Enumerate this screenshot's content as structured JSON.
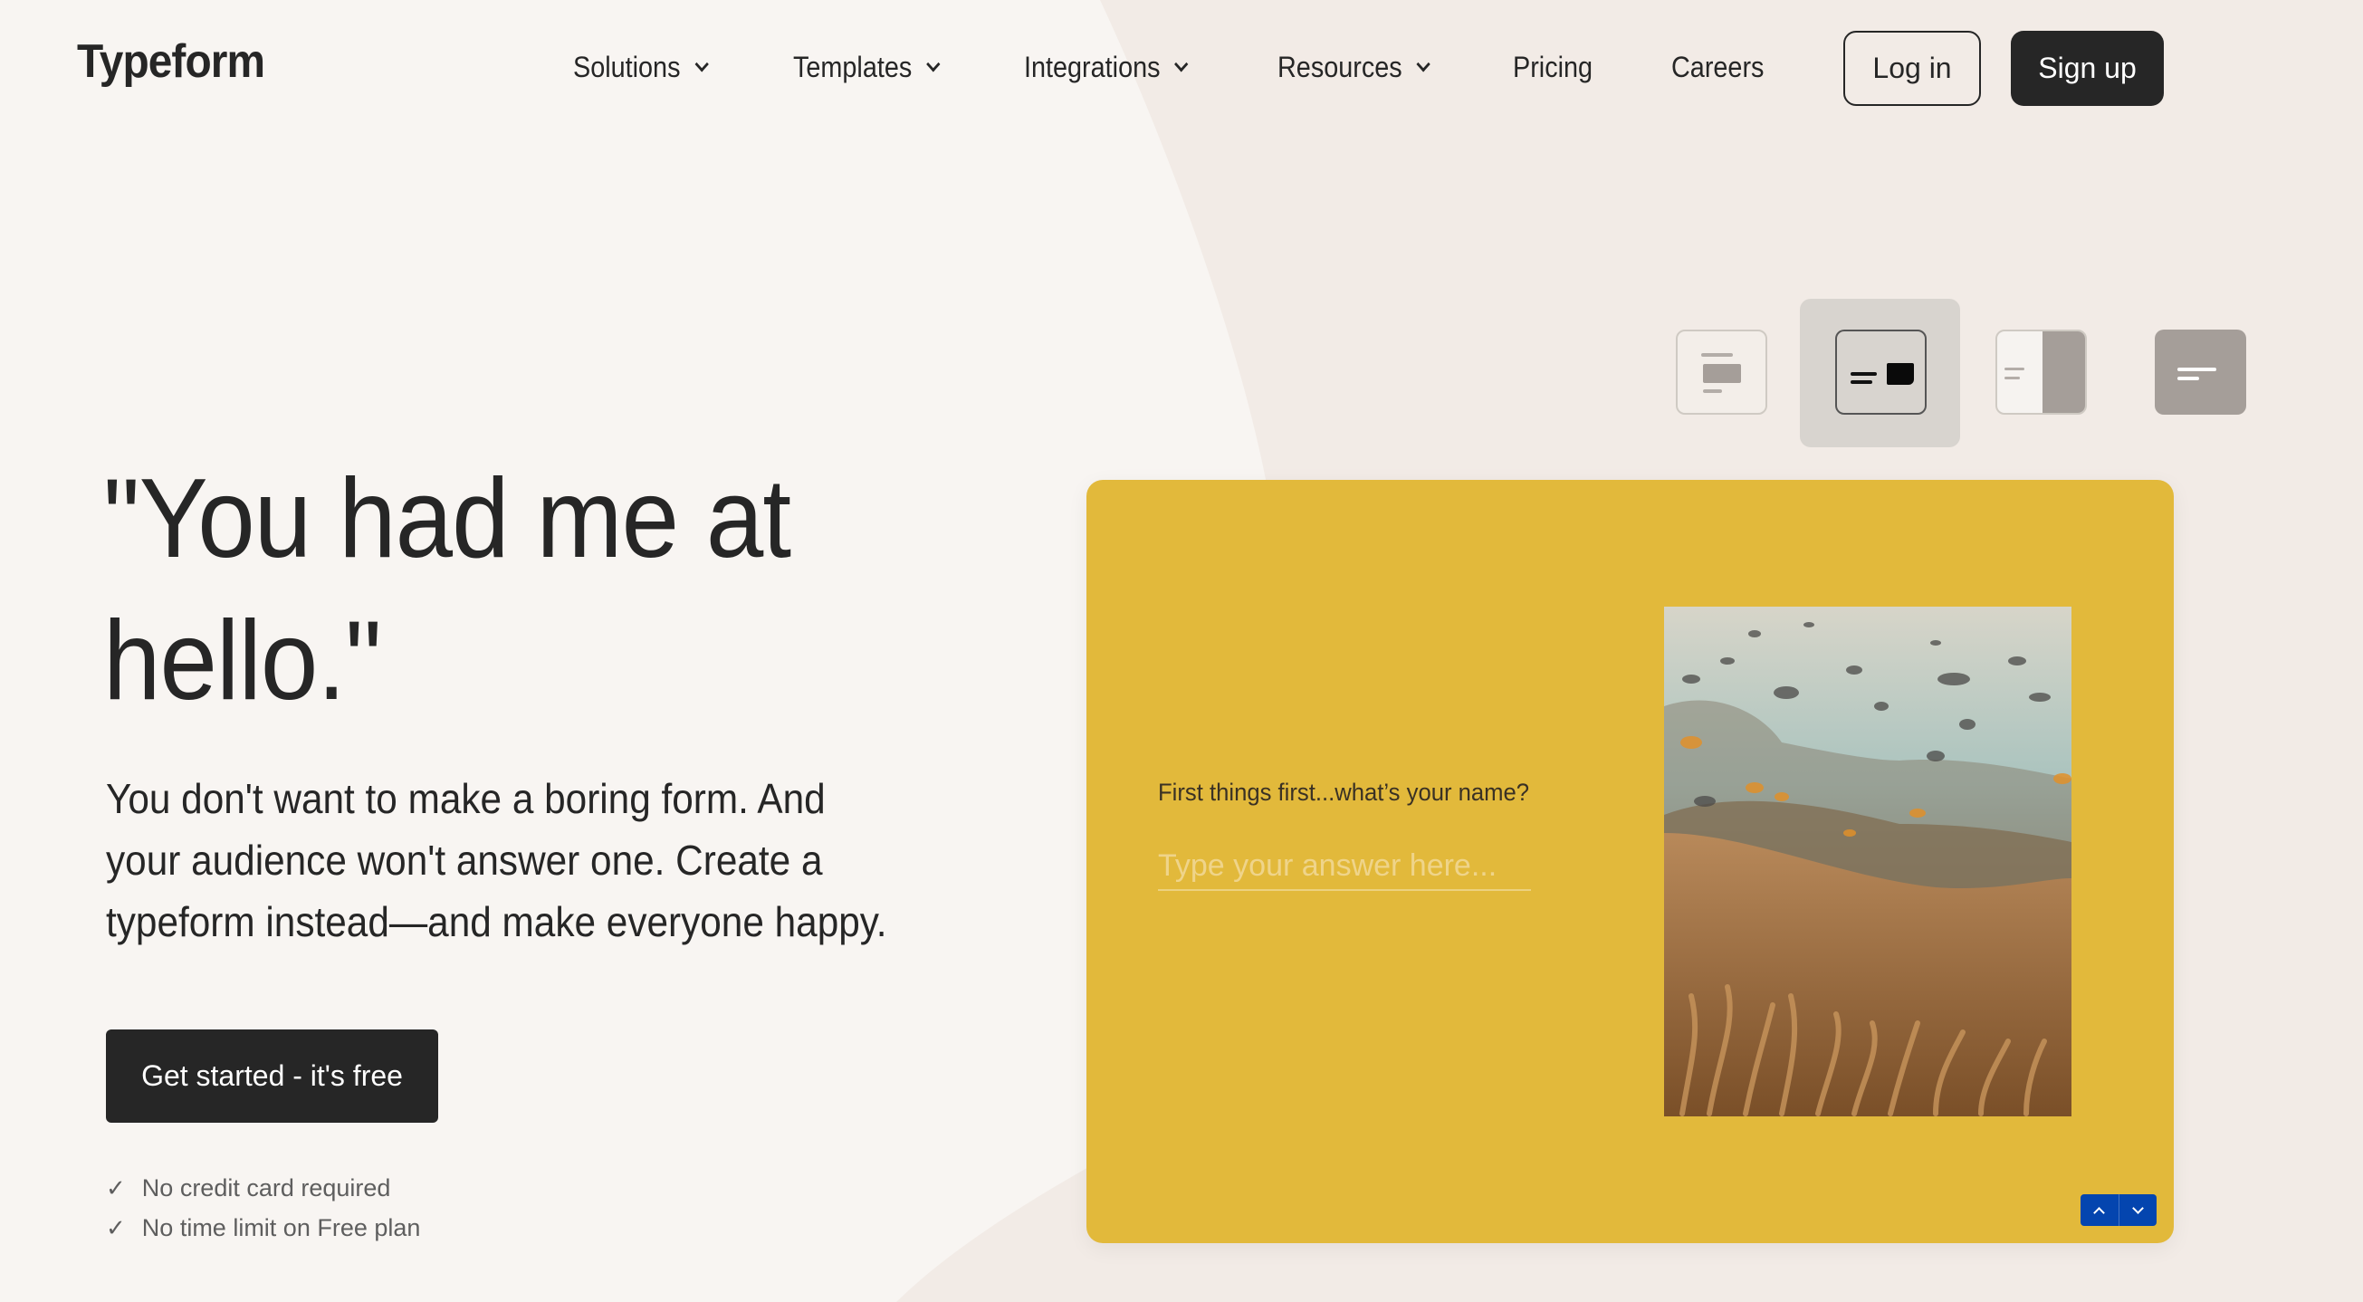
{
  "brand": {
    "name": "Typeform",
    "colors": {
      "text": "#262626",
      "background": "#f8f5f2",
      "background_blob": "#f2ebe6",
      "form_card": "#e2b93b",
      "form_nav": "#0445af"
    }
  },
  "nav": {
    "items": [
      {
        "label": "Solutions",
        "has_dropdown": true
      },
      {
        "label": "Templates",
        "has_dropdown": true
      },
      {
        "label": "Integrations",
        "has_dropdown": true
      },
      {
        "label": "Resources",
        "has_dropdown": true
      },
      {
        "label": "Pricing",
        "has_dropdown": false
      },
      {
        "label": "Careers",
        "has_dropdown": false
      }
    ],
    "login_label": "Log in",
    "signup_label": "Sign up"
  },
  "hero": {
    "headline_line1": "\"You had me at",
    "headline_line2": "hello.\"",
    "subtext_line1": "You don't want to make a boring form. And",
    "subtext_line2": "your audience won't answer one. Create a",
    "subtext_line3": "typeform instead—and make everyone happy.",
    "cta_label": "Get started - it's free",
    "checklist": [
      {
        "icon": "check-icon",
        "glyph": "✓",
        "text": "No credit card required"
      },
      {
        "icon": "check-icon",
        "glyph": "✓",
        "text": "No time limit on Free plan"
      }
    ]
  },
  "layout_switcher": {
    "options": [
      {
        "name": "stack-layout",
        "selected": false
      },
      {
        "name": "split-layout",
        "selected": true
      },
      {
        "name": "split-right-image-layout",
        "selected": false
      },
      {
        "name": "wallpaper-layout",
        "selected": false
      }
    ]
  },
  "form_preview": {
    "question": "First things first...what’s your name?",
    "answer_placeholder": "Type your answer here...",
    "answer_value": "",
    "image_description": "underwater coral reef with fish",
    "nav_up_icon": "chevron-up-icon",
    "nav_down_icon": "chevron-down-icon"
  }
}
